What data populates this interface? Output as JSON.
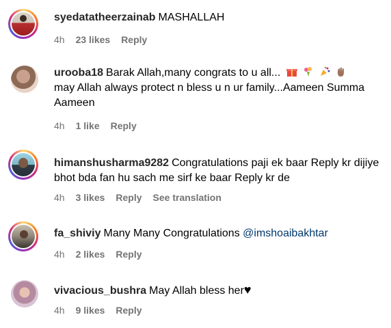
{
  "comments": [
    {
      "username": "syedatatheerzainab",
      "text": "MASHALLAH",
      "time": "4h",
      "likes": "23 likes",
      "reply": "Reply"
    },
    {
      "username": "urooba18",
      "text": "Barak Allah,many congrats to u all...",
      "text2": "may Allah always protect n bless u n ur family...Aameen Summa Aameen",
      "emojis": [
        "gift-icon",
        "bouquet-icon",
        "confetti-icon",
        "raised-hand-icon"
      ],
      "time": "4h",
      "likes": "1 like",
      "reply": "Reply"
    },
    {
      "username": "himanshusharma9282",
      "text": "Congratulations paji ek baar Reply kr dijiye bhot bda fan hu sach me sirf ke baar Reply kr de",
      "time": "4h",
      "likes": "3 likes",
      "reply": "Reply",
      "translation": "See translation"
    },
    {
      "username": "fa_shiviy",
      "text": "Many Many Congratulations",
      "mention": "@imshoaibakhtar",
      "time": "4h",
      "likes": "2 likes",
      "reply": "Reply"
    },
    {
      "username": "vivacious_bushra",
      "text": "May Allah bless her",
      "heart": "♥",
      "time": "4h",
      "likes": "9 likes",
      "reply": "Reply"
    }
  ]
}
